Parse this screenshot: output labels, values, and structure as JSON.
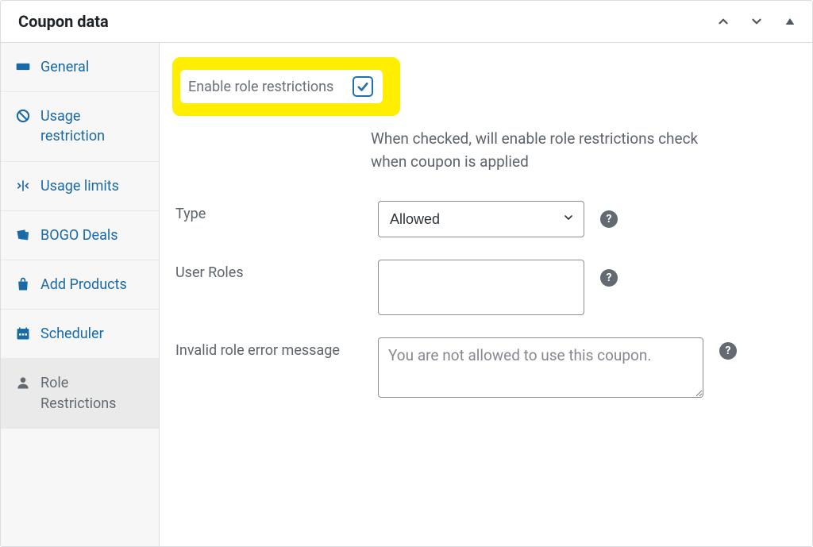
{
  "header": {
    "title": "Coupon data"
  },
  "sidebar": {
    "tabs": [
      {
        "id": "general",
        "label": "General"
      },
      {
        "id": "usage_restriction",
        "label": "Usage restriction"
      },
      {
        "id": "usage_limits",
        "label": "Usage limits"
      },
      {
        "id": "bogo_deals",
        "label": "BOGO Deals"
      },
      {
        "id": "add_products",
        "label": "Add Products"
      },
      {
        "id": "scheduler",
        "label": "Scheduler"
      },
      {
        "id": "role_restrictions",
        "label": "Role Restrictions",
        "active": true
      }
    ]
  },
  "form": {
    "enable": {
      "label": "Enable role restrictions",
      "checked": true
    },
    "desc": "When checked, will enable role restrictions check when coupon is applied",
    "type": {
      "label": "Type",
      "value": "Allowed",
      "options": [
        "Allowed"
      ]
    },
    "roles": {
      "label": "User Roles"
    },
    "message": {
      "label": "Invalid role error message",
      "placeholder": "You are not allowed to use this coupon."
    }
  }
}
